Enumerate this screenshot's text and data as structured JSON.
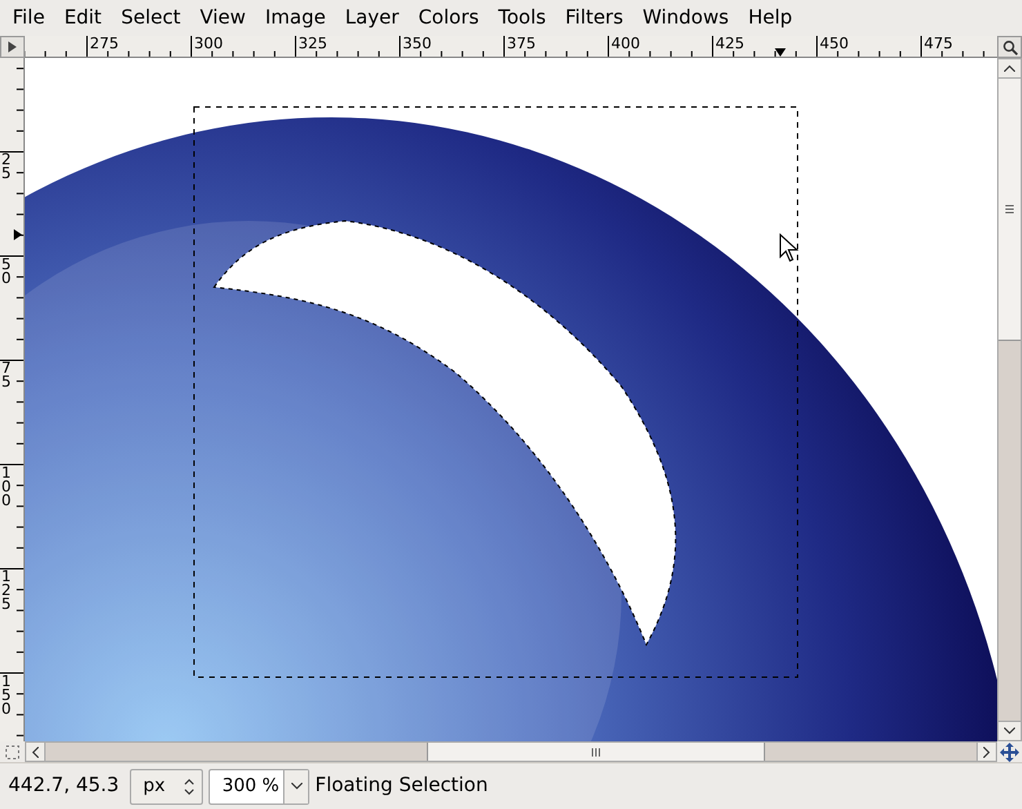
{
  "menu": [
    {
      "label": "File"
    },
    {
      "label": "Edit"
    },
    {
      "label": "Select"
    },
    {
      "label": "View"
    },
    {
      "label": "Image"
    },
    {
      "label": "Layer"
    },
    {
      "label": "Colors"
    },
    {
      "label": "Tools"
    },
    {
      "label": "Filters"
    },
    {
      "label": "Windows"
    },
    {
      "label": "Help"
    }
  ],
  "horizontal_ruler": {
    "labels": [
      "275",
      "300",
      "325",
      "350",
      "375",
      "400",
      "425",
      "450",
      "475"
    ]
  },
  "vertical_ruler": {
    "labels": [
      "25",
      "50",
      "75",
      "100",
      "125",
      "150"
    ]
  },
  "status_bar": {
    "pointer": "442.7, 45.3",
    "unit": "px",
    "zoom": "300 %",
    "message": "Floating Selection"
  }
}
